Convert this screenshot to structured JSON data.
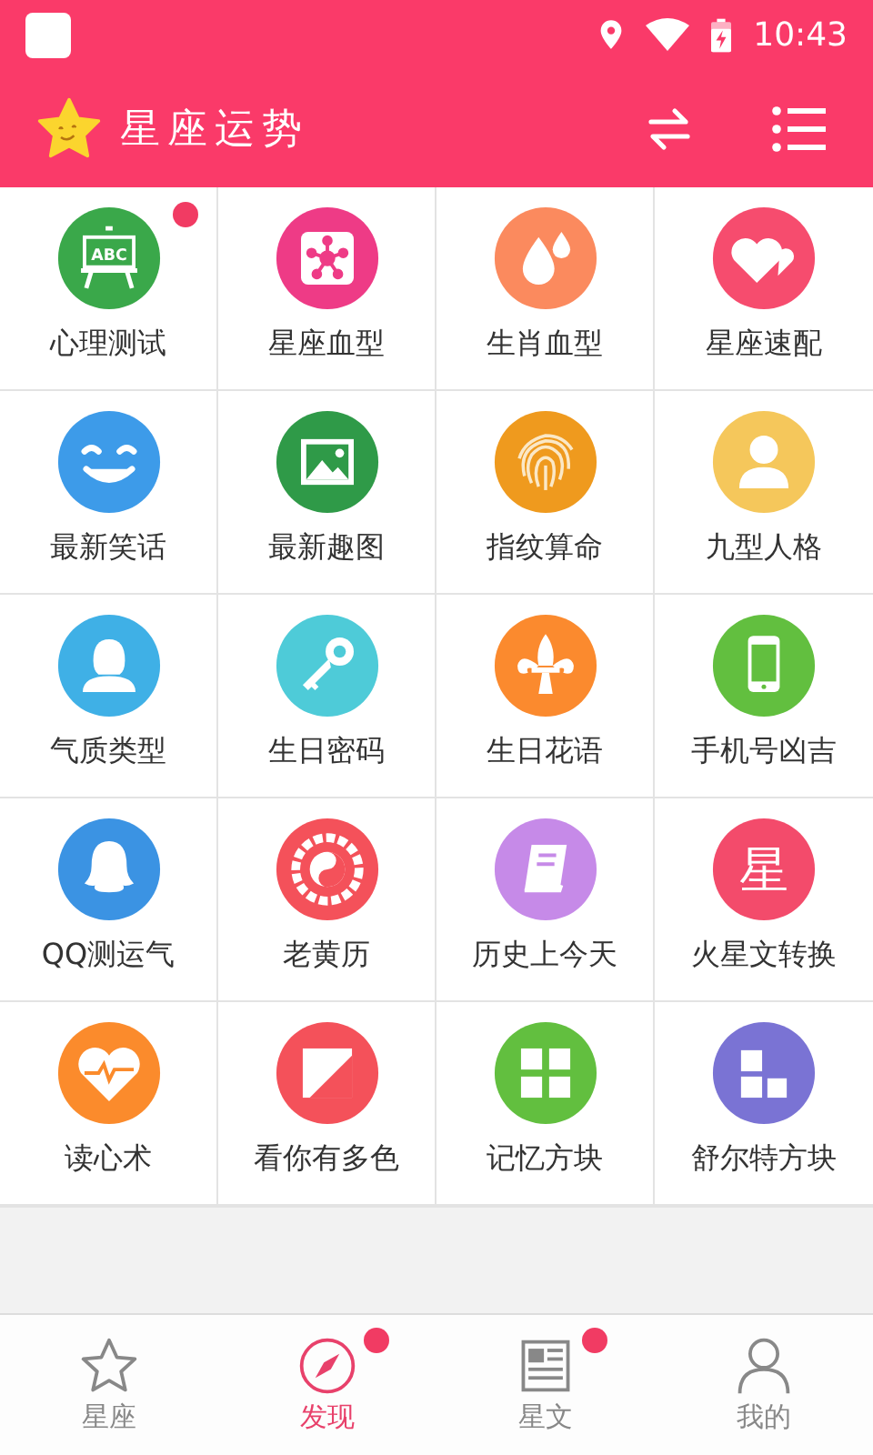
{
  "status_bar": {
    "time": "10:43"
  },
  "header": {
    "title": "星座运势"
  },
  "tiles": [
    {
      "label": "心理测试",
      "kind": "easel",
      "color": "#3aa84a",
      "badge": true,
      "glyph": "ABC"
    },
    {
      "label": "星座血型",
      "kind": "network",
      "color": "#ee3b86",
      "badge": false
    },
    {
      "label": "生肖血型",
      "kind": "drops",
      "color": "#fb8a5e",
      "badge": false
    },
    {
      "label": "星座速配",
      "kind": "hearts",
      "color": "#f64c6e",
      "badge": false
    },
    {
      "label": "最新笑话",
      "kind": "smile",
      "color": "#3d9be9",
      "badge": false
    },
    {
      "label": "最新趣图",
      "kind": "image",
      "color": "#2f9a48",
      "badge": false
    },
    {
      "label": "指纹算命",
      "kind": "fingerprint",
      "color": "#ef9a1e",
      "badge": false
    },
    {
      "label": "九型人格",
      "kind": "person",
      "color": "#f5c75b",
      "badge": false
    },
    {
      "label": "气质类型",
      "kind": "woman",
      "color": "#3fb0e6",
      "badge": false
    },
    {
      "label": "生日密码",
      "kind": "key",
      "color": "#4ecbd8",
      "badge": false
    },
    {
      "label": "生日花语",
      "kind": "fleur",
      "color": "#fb8a2e",
      "badge": false
    },
    {
      "label": "手机号凶吉",
      "kind": "phone",
      "color": "#62bf3f",
      "badge": false
    },
    {
      "label": "QQ测运气",
      "kind": "penguin",
      "color": "#3b93e3",
      "badge": false
    },
    {
      "label": "老黄历",
      "kind": "yinyang",
      "color": "#f4515a",
      "badge": false
    },
    {
      "label": "历史上今天",
      "kind": "book",
      "color": "#c68ae8",
      "badge": false
    },
    {
      "label": "火星文转换",
      "kind": "glyph",
      "color": "#f34b6b",
      "badge": false,
      "glyph": "星"
    },
    {
      "label": "读心术",
      "kind": "heartbeat",
      "color": "#fb8b2c",
      "badge": false
    },
    {
      "label": "看你有多色",
      "kind": "diagonal",
      "color": "#f4515a",
      "badge": false
    },
    {
      "label": "记忆方块",
      "kind": "grid",
      "color": "#62bf3f",
      "badge": false
    },
    {
      "label": "舒尔特方块",
      "kind": "blocks",
      "color": "#7a73d4",
      "badge": false
    }
  ],
  "nav": [
    {
      "label": "星座",
      "kind": "star",
      "selected": false,
      "badge": false
    },
    {
      "label": "发现",
      "kind": "compass",
      "selected": true,
      "badge": true
    },
    {
      "label": "星文",
      "kind": "news",
      "selected": false,
      "badge": true
    },
    {
      "label": "我的",
      "kind": "user",
      "selected": false,
      "badge": false
    }
  ]
}
